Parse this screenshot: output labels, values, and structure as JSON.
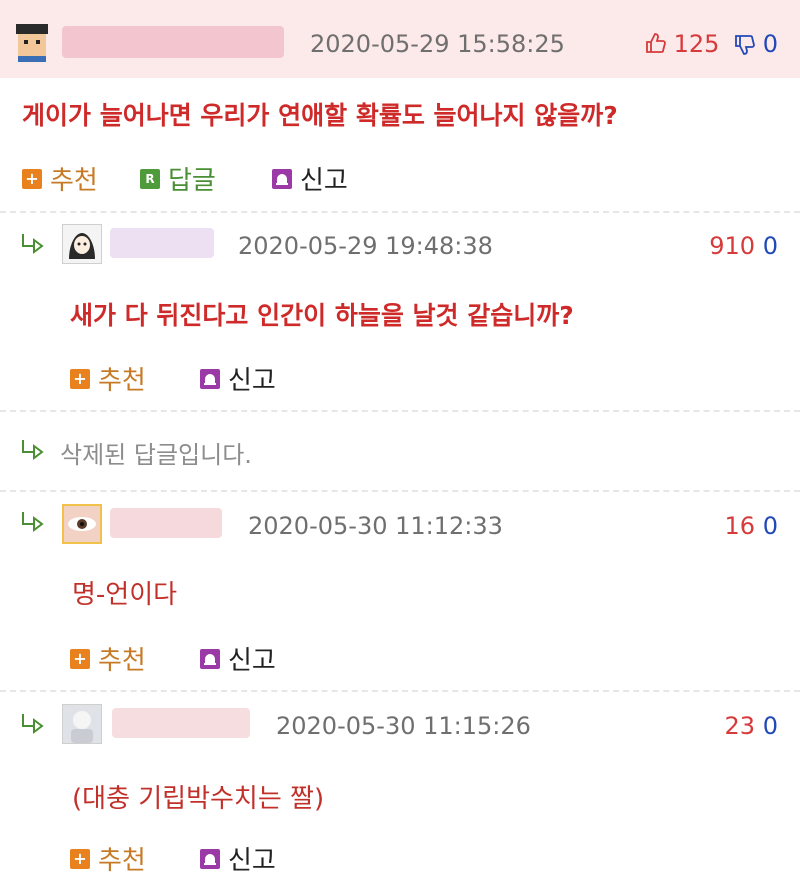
{
  "post": {
    "timestamp": "2020-05-29 15:58:25",
    "up_count": "125",
    "down_count": "0",
    "text": "게이가 늘어나면 우리가 연애할 확률도 늘어나지 않을까?",
    "actions": {
      "recommend": "추천",
      "reply": "답글",
      "report": "신고"
    }
  },
  "comments": [
    {
      "timestamp": "2020-05-29 19:48:38",
      "up": "910",
      "down": "0",
      "text": "새가 다 뒤진다고 인간이 하늘을 날것 같습니까?",
      "recommend": "추천",
      "report": "신고"
    },
    {
      "deleted_text": "삭제된 답글입니다."
    },
    {
      "timestamp": "2020-05-30 11:12:33",
      "up": "16",
      "down": "0",
      "text": "명-언이다",
      "recommend": "추천",
      "report": "신고"
    },
    {
      "timestamp": "2020-05-30 11:15:26",
      "up": "23",
      "down": "0",
      "text": "(대충 기립박수치는 짤)",
      "recommend": "추천",
      "report": "신고"
    }
  ],
  "colors": {
    "accent_red": "#cf2a2a",
    "down_blue": "#2149b8",
    "action_orange": "#c77a25",
    "reply_green": "#4a8f33",
    "post_bg": "#fce9ea"
  },
  "icons": [
    "thumbs-up-icon",
    "thumbs-down-icon",
    "plus-icon",
    "reply-r-icon",
    "report-icon",
    "reply-arrow-icon"
  ]
}
